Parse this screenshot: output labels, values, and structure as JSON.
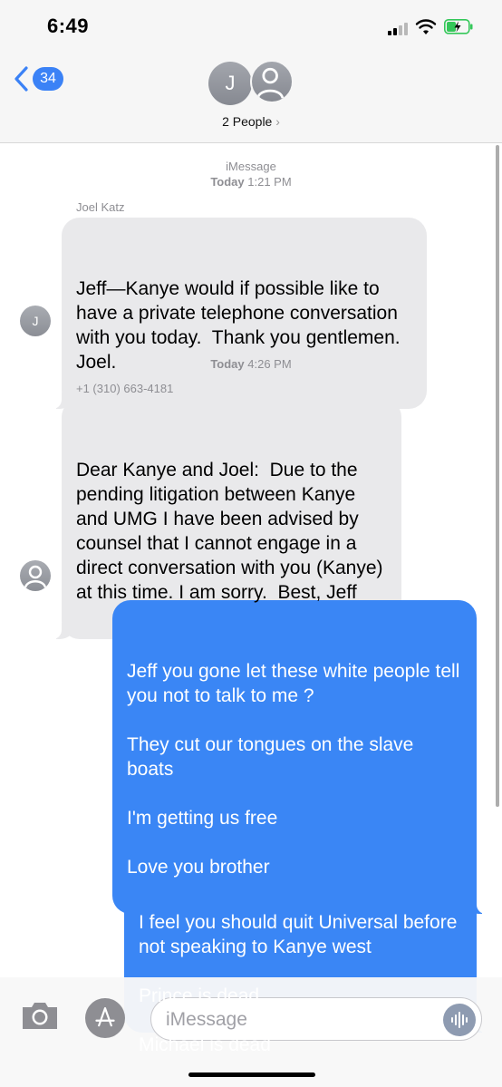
{
  "status_bar": {
    "time": "6:49"
  },
  "header": {
    "back_count": "34",
    "avatar_initial": "J",
    "title": "2 People",
    "title_chevron": "›"
  },
  "conversation": {
    "service_label": "iMessage",
    "first_timestamp_day": "Today",
    "first_timestamp_time": "1:21 PM",
    "second_timestamp_day": "Today",
    "second_timestamp_time": "4:26 PM",
    "messages": [
      {
        "direction": "incoming",
        "sender": "Joel Katz",
        "avatar": "J",
        "text": "Jeff—Kanye would if possible like to have a private telephone conversation with you today.  Thank you gentlemen.   Joel."
      },
      {
        "direction": "incoming",
        "sender": "+1 (310) 663-4181",
        "avatar": "person-icon",
        "text": "Dear Kanye and Joel:  Due to the pending litigation between Kanye and UMG I have been advised by counsel that I cannot engage in a direct conversation with you (Kanye) at this time. I am sorry.  Best, Jeff"
      },
      {
        "direction": "outgoing",
        "text": "Jeff you gone let these white people tell you not to talk to me ?\n\nThey cut our tongues on the slave boats\n\nI'm getting us free\n\nLove you brother"
      },
      {
        "direction": "outgoing",
        "text": "I feel you should quit Universal before not speaking to Kanye west\n\nPrince is dead\n\nMichael is dead"
      }
    ]
  },
  "input_bar": {
    "placeholder": "iMessage",
    "icons": [
      "camera-icon",
      "app-store-icon",
      "audio-waveform-icon"
    ]
  },
  "colors": {
    "outgoing_bubble": "#3a86f5",
    "incoming_bubble": "#e9e9eb",
    "accent": "#3b82f6"
  }
}
